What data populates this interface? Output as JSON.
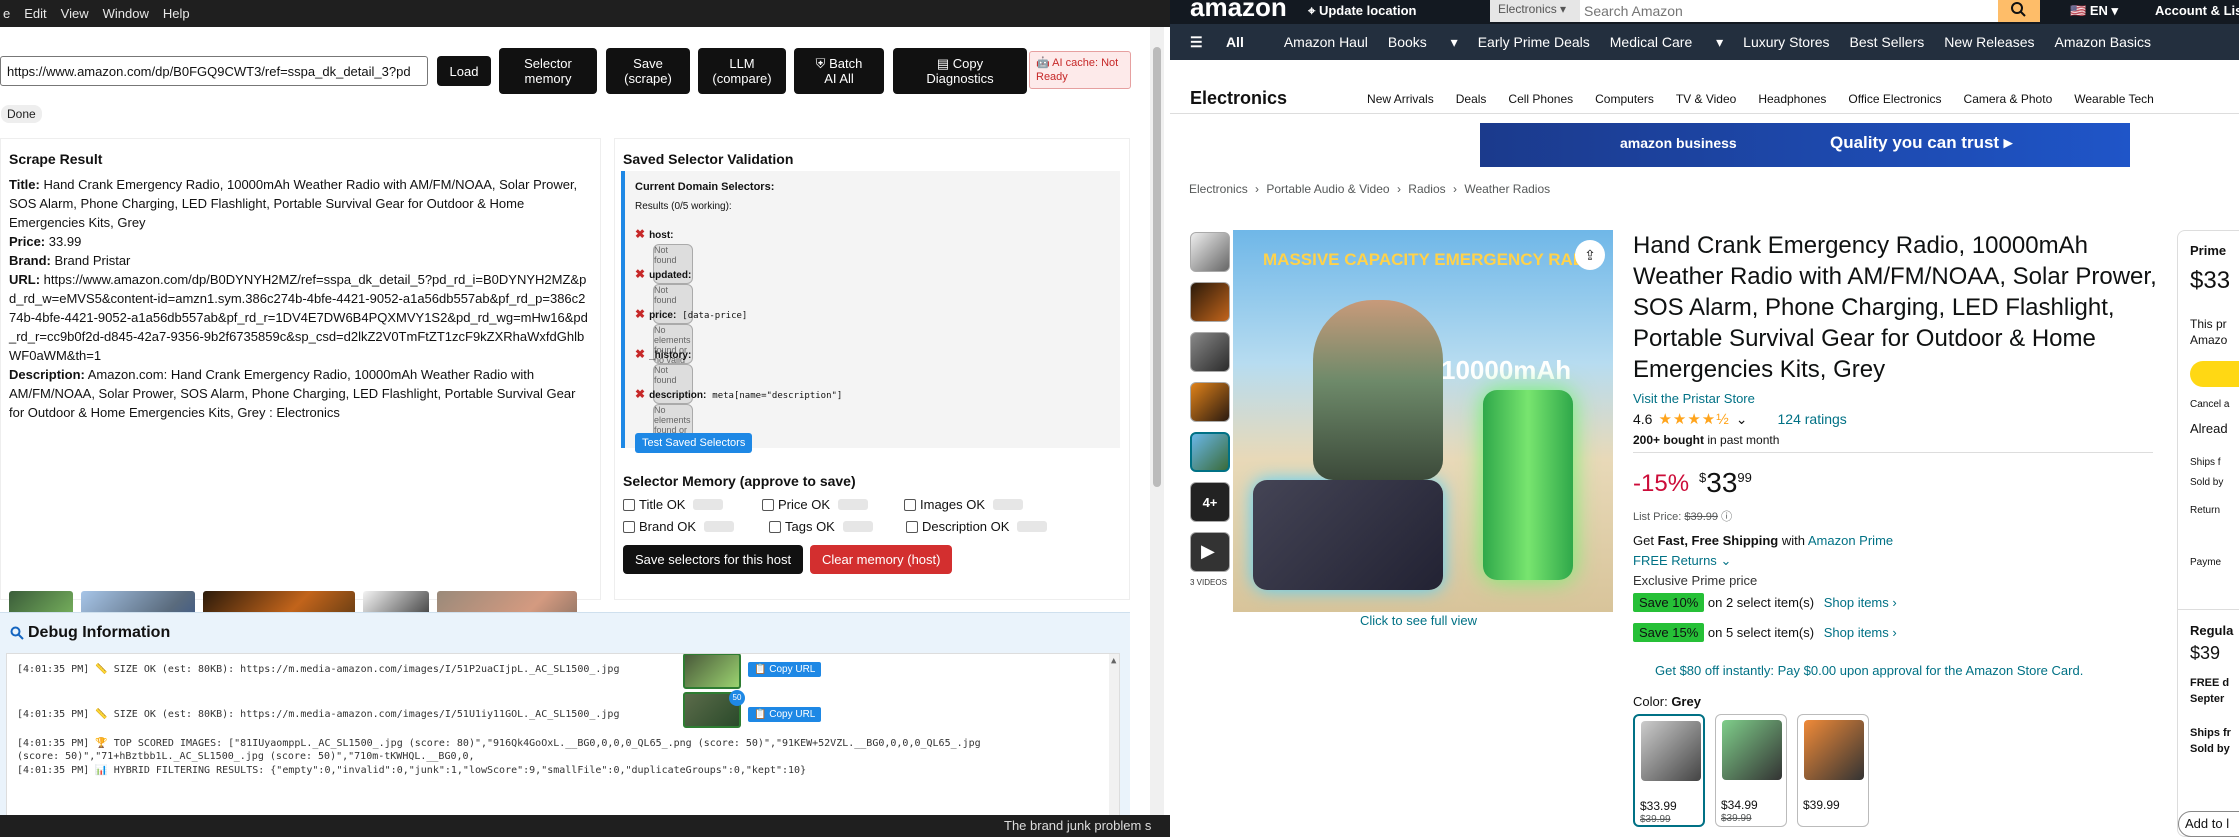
{
  "menubar": {
    "items": [
      "e",
      "Edit",
      "View",
      "Window",
      "Help"
    ]
  },
  "toolbar": {
    "url_value": "https://www.amazon.com/dp/B0FGQ9CWT3/ref=sspa_dk_detail_3?pd",
    "load": "Load",
    "selector_memory_1": "Selector",
    "selector_memory_2": "memory",
    "save_1": "Save",
    "save_2": "(scrape)",
    "llm_1": "LLM",
    "llm_2": "(compare)",
    "batch_1": "Batch",
    "batch_2": "AI All",
    "copy_1": "Copy",
    "copy_2": "Diagnostics",
    "cache_1": "AI cache: Not",
    "cache_2": "Ready",
    "status": "Done"
  },
  "scrape": {
    "heading": "Scrape Result",
    "title_label": "Title:",
    "title": "Hand Crank Emergency Radio, 10000mAh Weather Radio with AM/FM/NOAA, Solar Prower, SOS Alarm, Phone Charging, LED Flashlight, Portable Survival Gear for Outdoor & Home Emergencies Kits, Grey",
    "price_label": "Price:",
    "price": "33.99",
    "brand_label": "Brand:",
    "brand": "Brand Pristar",
    "url_label": "URL:",
    "url": "https://www.amazon.com/dp/B0DYNYH2MZ/ref=sspa_dk_detail_5?pd_rd_i=B0DYNYH2MZ&pd_rd_w=eMVS5&content-id=amzn1.sym.386c274b-4bfe-4421-9052-a1a56db557ab&pf_rd_p=386c274b-4bfe-4421-9052-a1a56db557ab&pf_rd_r=1DV4E7DW6B4PQXMVY1S2&pd_rd_wg=mHw16&pd_rd_r=cc9b0f2d-d845-42a7-9356-9b2f6735859c&sp_csd=d2lkZ2V0TmFtZT1zcF9kZXRhaWxfdGhlbWF0aWM&th=1",
    "desc_label": "Description:",
    "description": "Amazon.com: Hand Crank Emergency Radio, 10000mAh Weather Radio with AM/FM/NOAA, Solar Prower, SOS Alarm, Phone Charging, LED Flashlight, Portable Survival Gear for Outdoor & Home Emergencies Kits, Grey : Electronics"
  },
  "selectors": {
    "heading": "Saved Selector Validation",
    "current": "Current Domain Selectors:",
    "results": "Results (0/5 working):",
    "items": [
      {
        "name": "host:",
        "code": "",
        "status": "Not found"
      },
      {
        "name": "updated:",
        "code": "",
        "status": "Not found"
      },
      {
        "name": "price:",
        "code": "[data-price]",
        "status": "No elements found or no valid values extracted"
      },
      {
        "name": "_history:",
        "code": "",
        "status": "Not found"
      },
      {
        "name": "description:",
        "code": "meta[name=\"description\"]",
        "status": "No elements found or no valid values extracted"
      }
    ],
    "test_button": "Test Saved Selectors"
  },
  "memory": {
    "heading": "Selector Memory (approve to save)",
    "title_ok": "Title OK",
    "price_ok": "Price OK",
    "images_ok": "Images OK",
    "brand_ok": "Brand OK",
    "tags_ok": "Tags OK",
    "description_ok": "Description OK",
    "save_button": "Save selectors for this host",
    "clear_button": "Clear memory (host)"
  },
  "debug": {
    "heading": "Debug Information",
    "lines": [
      "[4:01:35 PM] 📏 SIZE OK (est: 80KB): https://m.media-amazon.com/images/I/51P2uaCIjpL._AC_SL1500_.jpg",
      "[4:01:35 PM] 📏 SIZE OK (est: 80KB): https://m.media-amazon.com/images/I/51U1iy11GOL._AC_SL1500_.jpg",
      "[4:01:35 PM] 🏆 TOP SCORED IMAGES: [\"81IUyaomppL._AC_SL1500_.jpg (score: 80)\",\"916Qk4GoOxL.__BG0,0,0,0_QL65_.png (score: 50)\",\"91KEW+52VZL.__BG0,0,0,0_QL65_.jpg",
      "(score: 50)\",\"71+hBztbb1L._AC_SL1500_.jpg (score: 50)\",\"710m-tKWHQL.__BG0,0,",
      "[4:01:35 PM] 📊 HYBRID FILTERING RESULTS: {\"empty\":0,\"invalid\":0,\"junk\":1,\"lowScore\":9,\"smallFile\":0,\"duplicateGroups\":0,\"kept\":10}"
    ],
    "copy_url": "📋 Copy URL",
    "badge": "50"
  },
  "taskbar": {
    "text": "The brand junk problem s"
  },
  "amazon": {
    "location": "Update location",
    "search_cat": "Electronics",
    "search_placeholder": "Search Amazon",
    "lang": "EN",
    "account": "Account & Lists",
    "nav": [
      "All",
      "Amazon Haul",
      "Books",
      "Early Prime Deals",
      "Medical Care",
      "Luxury Stores",
      "Best Sellers",
      "New Releases",
      "Amazon Basics"
    ],
    "vs": "VS",
    "sub_title": "Electronics",
    "sub_items": [
      "New Arrivals",
      "Deals",
      "Cell Phones",
      "Computers",
      "TV & Video",
      "Headphones",
      "Office Electronics",
      "Camera & Photo",
      "Wearable Tech"
    ],
    "banner_left": "amazon business",
    "banner_right": "Quality you can trust ▸",
    "crumbs": [
      "Electronics",
      "›",
      "Portable Audio & Video",
      "›",
      "Radios",
      "›",
      "Weather Radios"
    ],
    "more_images": "4+",
    "videos": "3 VIDEOS",
    "img_headline": "MASSIVE CAPACITY EMERGENCY RADI",
    "img_cap": "10000mAh",
    "click_full": "Click to see full view",
    "title": "Hand Crank Emergency Radio, 10000mAh Weather Radio with AM/FM/NOAA, Solar Prower, SOS Alarm, Phone Charging, LED Flashlight, Portable Survival Gear for Outdoor & Home Emergencies Kits, Grey",
    "store": "Visit the Pristar Store",
    "rating": "4.6",
    "rating_count": "124 ratings",
    "bought": "200+ bought",
    "bought_suffix": "in past month",
    "discount": "-15%",
    "price_sym": "$",
    "price_whole": "33",
    "price_frac": "99",
    "list_label": "List Price:",
    "list_price": "$39.99",
    "get_fast": "Get",
    "fast_free": "Fast, Free Shipping",
    "with": "with",
    "amazon_prime": "Amazon Prime",
    "free_returns": "FREE Returns",
    "exclusive": "Exclusive Prime price",
    "save10": "Save 10%",
    "save10_text": "on 2 select item(s)",
    "save15": "Save 15%",
    "save15_text": "on 5 select item(s)",
    "shop_items": "Shop items ›",
    "card_offer": "Get $80 off instantly: Pay $0.00 upon approval for the Amazon Store Card.",
    "color_label": "Color:",
    "color_value": "Grey",
    "swatches": [
      {
        "p1": "$33.99",
        "p2": "$39.99"
      },
      {
        "p1": "$34.99",
        "p2": "$39.99"
      },
      {
        "p1": "$39.99",
        "p2": ""
      }
    ],
    "buybox_prime": "Prime",
    "buybox_price": "$33",
    "buybox_this": "This pr",
    "buybox_amaz": "Amazo",
    "buybox_cancel": "Cancel a",
    "buybox_already": "Alread",
    "buybox_ships": "Ships f",
    "buybox_sold": "Sold by",
    "buybox_return": "Return",
    "buybox_paym": "Payme",
    "buybox_regular": "Regula",
    "buybox_price2": "$39",
    "buybox_free": "FREE d",
    "buybox_sept": "Septer",
    "buybox_ships2": "Ships fr",
    "buybox_sold2": "Sold by",
    "add_to": "Add to l"
  }
}
